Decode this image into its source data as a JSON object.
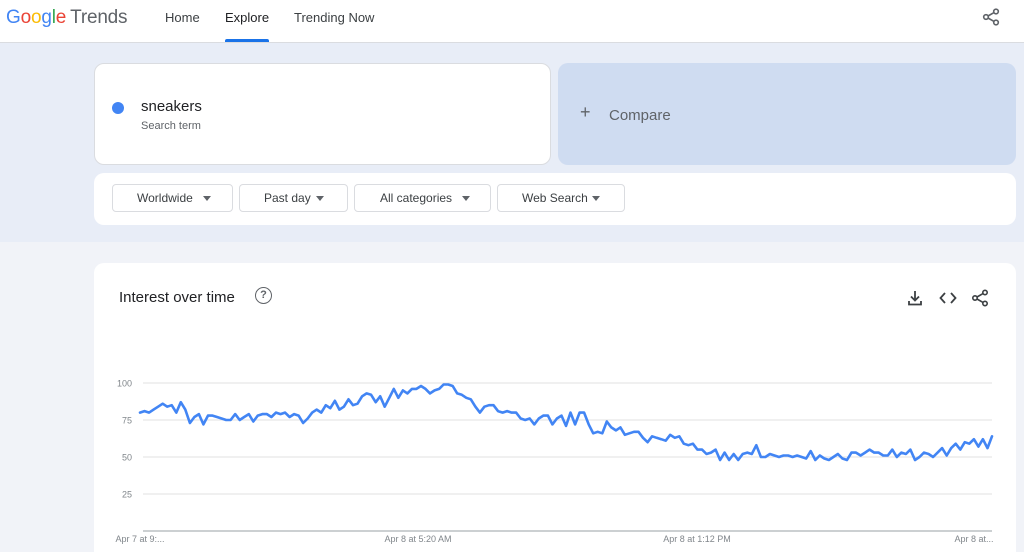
{
  "header": {
    "logo_google": "Google",
    "logo_trends": "Trends",
    "nav": [
      {
        "label": "Home"
      },
      {
        "label": "Explore"
      },
      {
        "label": "Trending Now"
      }
    ],
    "share_icon": "share-icon"
  },
  "search": {
    "term": "sneakers",
    "term_type": "Search term",
    "term_color": "#4285f4",
    "compare_label": "Compare"
  },
  "filters": [
    {
      "label": "Worldwide"
    },
    {
      "label": "Past day"
    },
    {
      "label": "All categories"
    },
    {
      "label": "Web Search"
    }
  ],
  "panel": {
    "title": "Interest over time",
    "icons": [
      "help-icon",
      "download-icon",
      "embed-icon",
      "share-icon"
    ]
  },
  "chart_data": {
    "type": "line",
    "title": "",
    "xlabel": "",
    "ylabel": "",
    "ylim": [
      0,
      100
    ],
    "yticks": [
      25,
      50,
      75,
      100
    ],
    "x_tick_labels": [
      "Apr 7 at 9:...",
      "Apr 8 at 5:20 AM",
      "Apr 8 at 1:12 PM",
      "Apr 8 at..."
    ],
    "grid": true,
    "series": [
      {
        "color": "#4285f4",
        "values": [
          80,
          81,
          80,
          82,
          84,
          86,
          84,
          85,
          80,
          87,
          82,
          73,
          77,
          79,
          72,
          78,
          78,
          77,
          76,
          75,
          75,
          79,
          75,
          77,
          79,
          74,
          78,
          79,
          79,
          77,
          80,
          79,
          80,
          77,
          79,
          78,
          73,
          76,
          80,
          82,
          80,
          85,
          83,
          88,
          82,
          84,
          89,
          85,
          86,
          91,
          93,
          92,
          87,
          91,
          84,
          90,
          96,
          90,
          95,
          93,
          96,
          96,
          98,
          96,
          93,
          95,
          96,
          99,
          99,
          98,
          93,
          92,
          90,
          89,
          84,
          80,
          84,
          85,
          85,
          81,
          80,
          81,
          80,
          80,
          76,
          75,
          76,
          72,
          76,
          78,
          78,
          72,
          76,
          78,
          71,
          80,
          72,
          80,
          80,
          72,
          66,
          67,
          66,
          74,
          70,
          68,
          70,
          65,
          66,
          67,
          67,
          63,
          60,
          64,
          63,
          62,
          61,
          65,
          63,
          64,
          59,
          58,
          59,
          55,
          55,
          52,
          53,
          55,
          48,
          53,
          48,
          52,
          48,
          52,
          53,
          52,
          58,
          50,
          50,
          52,
          51,
          50,
          51,
          51,
          50,
          51,
          50,
          49,
          54,
          48,
          51,
          49,
          48,
          50,
          52,
          49,
          48,
          53,
          53,
          51,
          53,
          55,
          53,
          53,
          51,
          51,
          55,
          50,
          53,
          52,
          55,
          48,
          50,
          53,
          52,
          50,
          53,
          56,
          51,
          56,
          59,
          55,
          60,
          59,
          62,
          57,
          62,
          56,
          64
        ]
      }
    ]
  }
}
